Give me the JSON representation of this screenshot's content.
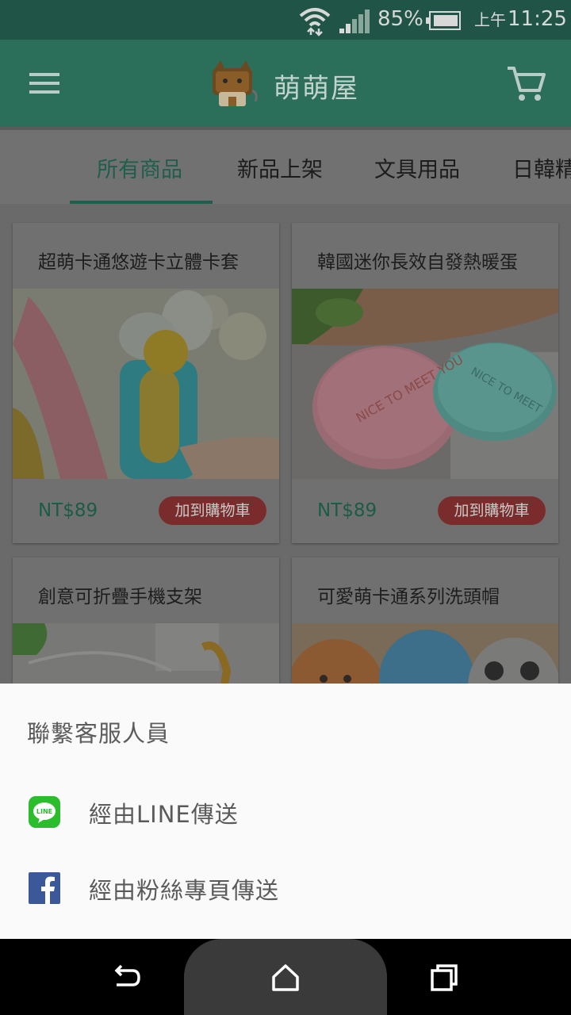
{
  "status_bar": {
    "battery_pct": "85%",
    "time_ampm": "上午",
    "time": "11:25",
    "icons": [
      "wifi-icon",
      "cell-signal-icon",
      "battery-icon"
    ]
  },
  "app_bar": {
    "title": "萌萌屋",
    "icons": [
      "menu-icon",
      "logo",
      "cart-icon"
    ]
  },
  "tabs": [
    {
      "label": "所有商品",
      "active": true
    },
    {
      "label": "新品上架",
      "active": false
    },
    {
      "label": "文具用品",
      "active": false
    },
    {
      "label": "日韓精",
      "active": false
    }
  ],
  "products": [
    {
      "title": "超萌卡通悠遊卡立體卡套",
      "price": "NT$89",
      "add_label": "加到購物車"
    },
    {
      "title": "韓國迷你長效自發熱暖蛋",
      "price": "NT$89",
      "add_label": "加到購物車"
    },
    {
      "title": "創意可折疊手機支架"
    },
    {
      "title": "可愛萌卡通系列洗頭帽"
    }
  ],
  "sheet": {
    "title": "聯繫客服人員",
    "items": [
      {
        "label": "經由LINE傳送",
        "icon": "line-icon"
      },
      {
        "label": "經由粉絲專頁傳送",
        "icon": "facebook-icon"
      }
    ]
  },
  "nav": {
    "icons": [
      "back-icon",
      "home-icon",
      "recents-icon"
    ]
  },
  "colors": {
    "primary": "#3aa07e",
    "add_button": "#e04848",
    "price": "#2e9a6e",
    "sheet_bg": "#fafafa"
  }
}
